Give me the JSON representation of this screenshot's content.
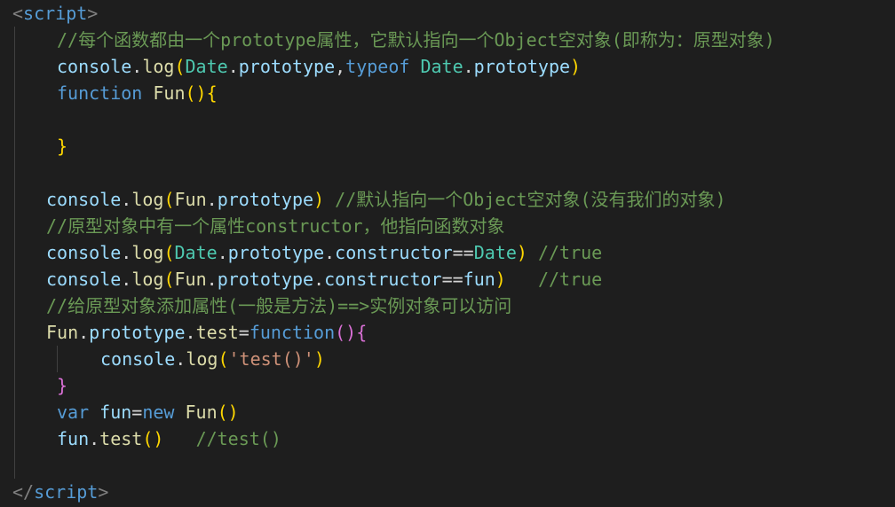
{
  "lines": [
    [
      {
        "c": "punct",
        "t": "<"
      },
      {
        "c": "tag",
        "t": "script"
      },
      {
        "c": "punct",
        "t": ">"
      }
    ],
    [
      {
        "c": "comment",
        "t": "//每个函数都由一个prototype属性，它默认指向一个Object空对象(即称为：原型对象)"
      }
    ],
    [
      {
        "c": "ident",
        "t": "console"
      },
      {
        "c": "plain",
        "t": "."
      },
      {
        "c": "func",
        "t": "log"
      },
      {
        "c": "bracket",
        "t": "("
      },
      {
        "c": "class",
        "t": "Date"
      },
      {
        "c": "plain",
        "t": "."
      },
      {
        "c": "ident",
        "t": "prototype"
      },
      {
        "c": "plain",
        "t": ","
      },
      {
        "c": "keyword",
        "t": "typeof"
      },
      {
        "c": "plain",
        "t": " "
      },
      {
        "c": "class",
        "t": "Date"
      },
      {
        "c": "plain",
        "t": "."
      },
      {
        "c": "ident",
        "t": "prototype"
      },
      {
        "c": "bracket",
        "t": ")"
      }
    ],
    [
      {
        "c": "keyword",
        "t": "function"
      },
      {
        "c": "plain",
        "t": " "
      },
      {
        "c": "func",
        "t": "Fun"
      },
      {
        "c": "bracket",
        "t": "()"
      },
      {
        "c": "bracket",
        "t": "{"
      }
    ],
    [],
    [
      {
        "c": "bracket",
        "t": "}"
      }
    ],
    [],
    [
      {
        "c": "ident",
        "t": "console"
      },
      {
        "c": "plain",
        "t": "."
      },
      {
        "c": "func",
        "t": "log"
      },
      {
        "c": "bracket",
        "t": "("
      },
      {
        "c": "func",
        "t": "Fun"
      },
      {
        "c": "plain",
        "t": "."
      },
      {
        "c": "ident",
        "t": "prototype"
      },
      {
        "c": "bracket",
        "t": ")"
      },
      {
        "c": "plain",
        "t": " "
      },
      {
        "c": "comment",
        "t": "//默认指向一个Object空对象(没有我们的对象)"
      }
    ],
    [
      {
        "c": "comment",
        "t": "//原型对象中有一个属性constructor，他指向函数对象"
      }
    ],
    [
      {
        "c": "ident",
        "t": "console"
      },
      {
        "c": "plain",
        "t": "."
      },
      {
        "c": "func",
        "t": "log"
      },
      {
        "c": "bracket",
        "t": "("
      },
      {
        "c": "class",
        "t": "Date"
      },
      {
        "c": "plain",
        "t": "."
      },
      {
        "c": "ident",
        "t": "prototype"
      },
      {
        "c": "plain",
        "t": "."
      },
      {
        "c": "ident",
        "t": "constructor"
      },
      {
        "c": "op",
        "t": "=="
      },
      {
        "c": "class",
        "t": "Date"
      },
      {
        "c": "bracket",
        "t": ")"
      },
      {
        "c": "plain",
        "t": " "
      },
      {
        "c": "comment",
        "t": "//true"
      }
    ],
    [
      {
        "c": "ident",
        "t": "console"
      },
      {
        "c": "plain",
        "t": "."
      },
      {
        "c": "func",
        "t": "log"
      },
      {
        "c": "bracket",
        "t": "("
      },
      {
        "c": "func",
        "t": "Fun"
      },
      {
        "c": "plain",
        "t": "."
      },
      {
        "c": "ident",
        "t": "prototype"
      },
      {
        "c": "plain",
        "t": "."
      },
      {
        "c": "ident",
        "t": "constructor"
      },
      {
        "c": "op",
        "t": "=="
      },
      {
        "c": "ident",
        "t": "fun"
      },
      {
        "c": "bracket",
        "t": ")"
      },
      {
        "c": "plain",
        "t": "   "
      },
      {
        "c": "comment",
        "t": "//true"
      }
    ],
    [
      {
        "c": "comment",
        "t": "//给原型对象添加属性(一般是方法)==>实例对象可以访问"
      }
    ],
    [
      {
        "c": "func",
        "t": "Fun"
      },
      {
        "c": "plain",
        "t": "."
      },
      {
        "c": "ident",
        "t": "prototype"
      },
      {
        "c": "plain",
        "t": "."
      },
      {
        "c": "func",
        "t": "test"
      },
      {
        "c": "op",
        "t": "="
      },
      {
        "c": "keyword",
        "t": "function"
      },
      {
        "c": "bracket2",
        "t": "()"
      },
      {
        "c": "bracket2",
        "t": "{"
      }
    ],
    [
      {
        "c": "ident",
        "t": "console"
      },
      {
        "c": "plain",
        "t": "."
      },
      {
        "c": "func",
        "t": "log"
      },
      {
        "c": "bracket",
        "t": "("
      },
      {
        "c": "string",
        "t": "'test()'"
      },
      {
        "c": "bracket",
        "t": ")"
      }
    ],
    [
      {
        "c": "bracket2",
        "t": "}"
      }
    ],
    [
      {
        "c": "keyword",
        "t": "var"
      },
      {
        "c": "plain",
        "t": " "
      },
      {
        "c": "ident",
        "t": "fun"
      },
      {
        "c": "op",
        "t": "="
      },
      {
        "c": "keyword",
        "t": "new"
      },
      {
        "c": "plain",
        "t": " "
      },
      {
        "c": "func",
        "t": "Fun"
      },
      {
        "c": "bracket",
        "t": "()"
      }
    ],
    [
      {
        "c": "ident",
        "t": "fun"
      },
      {
        "c": "plain",
        "t": "."
      },
      {
        "c": "func",
        "t": "test"
      },
      {
        "c": "bracket",
        "t": "()"
      },
      {
        "c": "plain",
        "t": "   "
      },
      {
        "c": "comment",
        "t": "//test()"
      }
    ],
    [],
    [
      {
        "c": "punct",
        "t": "</"
      },
      {
        "c": "tag",
        "t": "script"
      },
      {
        "c": "punct",
        "t": ">"
      }
    ]
  ]
}
